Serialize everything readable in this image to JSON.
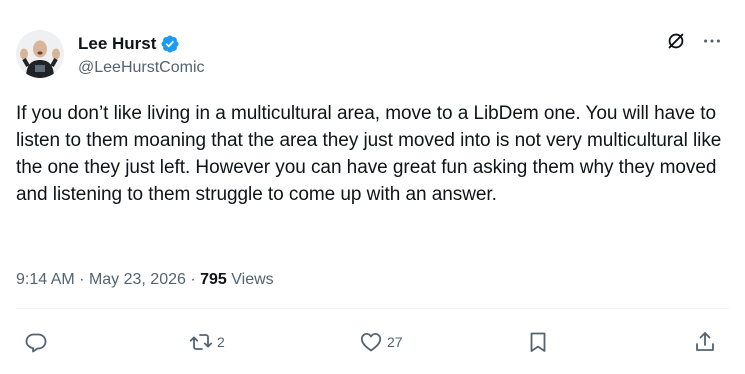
{
  "author": {
    "display_name": "Lee Hurst",
    "handle": "@LeeHurstComic",
    "verified": true
  },
  "tweet": {
    "text": "If you don’t like living in a multicultural area, move to a LibDem one. You will have to listen to them moaning that the area they just moved into is not very multicultural like the one they just left. However you can have great fun asking them why they moved and listening to them struggle to come up with an answer.",
    "time": "9:14 AM",
    "date": "May 23, 2026",
    "views_count": "795",
    "views_label": "Views"
  },
  "actions": {
    "reply_count": "",
    "retweet_count": "2",
    "like_count": "27"
  },
  "icons": {
    "grok": "grok-icon",
    "more": "more-icon",
    "verified": "verified-badge-icon",
    "reply": "reply-icon",
    "retweet": "retweet-icon",
    "like": "heart-icon",
    "bookmark": "bookmark-icon",
    "share": "share-icon"
  },
  "colors": {
    "text_primary": "#0f1419",
    "text_secondary": "#536471",
    "verified_blue": "#1d9bf0",
    "divider": "#eff3f4"
  }
}
